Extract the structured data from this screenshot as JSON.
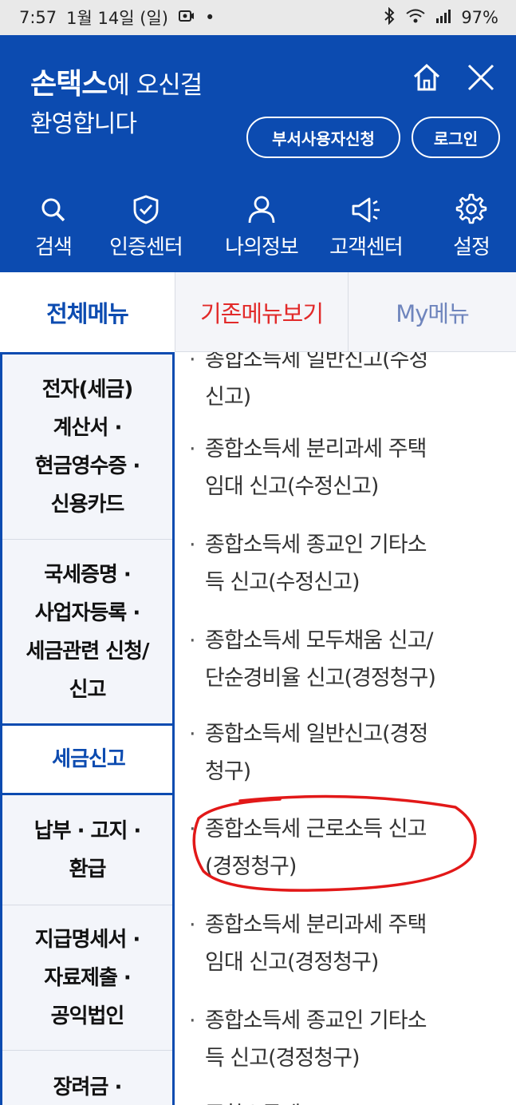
{
  "status_bar": {
    "time": "7:57",
    "date": "1월 14일 (일)",
    "battery": "97%"
  },
  "header": {
    "brand": "손택스",
    "welcome_suffix": "에 오신걸",
    "welcome_line2": "환영합니다",
    "dept_user_button": "부서사용자신청",
    "login_button": "로그인"
  },
  "quick_menu": [
    {
      "label": "검색",
      "icon": "search-icon"
    },
    {
      "label": "인증센터",
      "icon": "shield-check-icon"
    },
    {
      "label": "나의정보",
      "icon": "user-icon"
    },
    {
      "label": "고객센터",
      "icon": "megaphone-icon"
    },
    {
      "label": "설정",
      "icon": "gear-icon"
    }
  ],
  "tabs": {
    "all": "전체메뉴",
    "legacy": "기존메뉴보기",
    "my": "My메뉴"
  },
  "left_menu": [
    {
      "lines": [
        "전자(세금)",
        "계산서 ·",
        "현금영수증 ·",
        "신용카드"
      ]
    },
    {
      "lines": [
        "국세증명 ·",
        "사업자등록 ·",
        "세금관련 신청/",
        "신고"
      ]
    },
    {
      "lines": [
        "세금신고"
      ],
      "active": true
    },
    {
      "lines": [
        "납부 · 고지 ·",
        "환급"
      ]
    },
    {
      "lines": [
        "지급명세서 ·",
        "자료제출 ·",
        "공익법인"
      ]
    },
    {
      "lines": [
        "장려금 ·"
      ]
    }
  ],
  "right_list": [
    {
      "lines": [
        "종합소득세 일반신고(수정",
        "신고)"
      ]
    },
    {
      "lines": [
        "종합소득세 분리과세 주택",
        "임대 신고(수정신고)"
      ]
    },
    {
      "lines": [
        "종합소득세 종교인 기타소",
        "득 신고(수정신고)"
      ]
    },
    {
      "lines": [
        "종합소득세 모두채움 신고/",
        "단순경비율 신고(경정청구)"
      ]
    },
    {
      "lines": [
        "종합소득세 일반신고(경정",
        "청구)"
      ]
    },
    {
      "lines": [
        "종합소득세 근로소득 신고",
        "(경정청구)"
      ]
    },
    {
      "lines": [
        "종합소득세 분리과세 주택",
        "임대 신고(경정청구)"
      ]
    },
    {
      "lines": [
        "종합소득세 종교인 기타소",
        "득 신고(경정청구)"
      ]
    },
    {
      "lines": [
        "종합소득세 ..."
      ]
    }
  ],
  "colors": {
    "brand_blue": "#0c4bb0",
    "legacy_red": "#e22a2a",
    "annotation_red": "#e21818"
  }
}
